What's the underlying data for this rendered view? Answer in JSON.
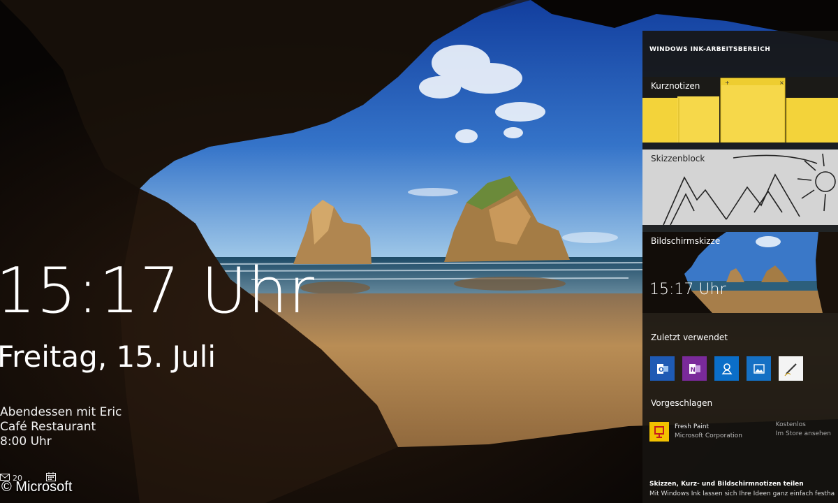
{
  "lock_screen": {
    "time": "15:17 Uhr",
    "date": "Freitag, 15. Juli",
    "appointment": {
      "title": "Abendessen mit Eric",
      "location": "Café Restaurant",
      "time": "8:00 Uhr"
    },
    "status": [
      {
        "icon": "mail-icon",
        "count": "20"
      },
      {
        "icon": "calendar-icon",
        "count": ""
      }
    ]
  },
  "watermark": "© Microsoft",
  "ink_workspace": {
    "title": "WINDOWS INK-ARBEITSBEREICH",
    "tiles": {
      "sticky_notes": {
        "label": "Kurznotizen",
        "icon": "sticky-notes-icon"
      },
      "sketchpad": {
        "label": "Skizzenblock",
        "icon": "sketch-icon"
      },
      "screen_sketch": {
        "label": "Bildschirmskizze",
        "time": "15:17 Uhr",
        "icon": "screenshot-icon"
      }
    },
    "recent_heading": "Zuletzt verwendet",
    "recent_apps": [
      {
        "name": "outlook-app",
        "color": "#1e5ab4"
      },
      {
        "name": "onenote-app",
        "color": "#7a2a9a"
      },
      {
        "name": "maps-app",
        "color": "#0b6ec8"
      },
      {
        "name": "photos-app",
        "color": "#1570c4"
      },
      {
        "name": "sketch-app",
        "color": "#f4f4f4"
      }
    ],
    "suggested_heading": "Vorgeschlagen",
    "suggested": {
      "name": "Fresh Paint",
      "publisher": "Microsoft Corporation",
      "right_line1": "Kostenlos",
      "right_line2": "Im Store ansehen"
    },
    "tip": {
      "line1": "Skizzen, Kurz- und Bildschirmnotizen teilen",
      "line2": "Mit Windows Ink lassen sich Ihre Ideen ganz einfach festhalten und teilen"
    }
  },
  "colors": {
    "sky_top": "#2a5ec4",
    "sky_bottom": "#8ec2ee",
    "sand": "#b68a4e",
    "sea": "#2c5f7c",
    "rock": "#120d09",
    "sticky_yellow": "#f3d33a",
    "panel_bg": "#161411"
  }
}
